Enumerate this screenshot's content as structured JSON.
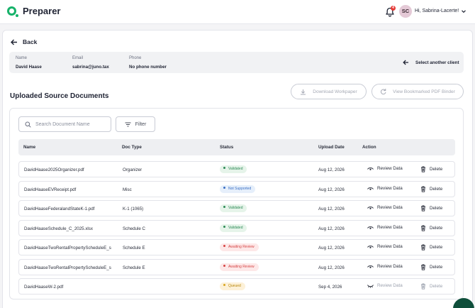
{
  "header": {
    "logo_text": "Preparer",
    "notification_count": "4",
    "avatar_initials": "SC",
    "greeting": "Hi, Sabrina-Lacerte!",
    "icons": [
      "logo-icon",
      "bell-icon",
      "chevron-down-icon"
    ]
  },
  "nav": {
    "back_label": "Back"
  },
  "client": {
    "name_label": "Name",
    "name": "David Haase",
    "email_label": "Email",
    "email": "sabrina@juno.tax",
    "phone_label": "Phone",
    "phone": "No phone number",
    "select_label": "Select another client"
  },
  "section": {
    "title": "Uploaded Source Documents",
    "download_label": "Download Workpaper",
    "view_binder_label": "View Bookmarked PDF Binder"
  },
  "toolbar": {
    "search_placeholder": "Search Document Name",
    "filter_label": "Filter"
  },
  "table": {
    "columns": [
      "Name",
      "Doc Type",
      "Status",
      "Upload Date",
      "Action"
    ],
    "review_label": "Review Data",
    "delete_label": "Delete",
    "rows": [
      {
        "name": "DavidHaase2025Organizer.pdf",
        "type": "Organizer",
        "status": "Validated",
        "date": "Aug 12, 2026"
      },
      {
        "name": "DavidHaaseEVReceipt.pdf",
        "type": "Misc",
        "status": "Not Supported",
        "date": "Aug 12, 2026"
      },
      {
        "name": "DavidHaaseFederalandStateK-1.pdf",
        "type": "K-1 (1065)",
        "status": "Validated",
        "date": "Aug 12, 2026"
      },
      {
        "name": "DavidHaaseSchedule_C_2025.xlsx",
        "type": "Schedule C",
        "status": "Validated",
        "date": "Aug 12, 2026"
      },
      {
        "name": "DavidHaaseTwoRentalPropertyScheduleE_s",
        "type": "Schedule E",
        "status": "Awaiting Review",
        "date": "Aug 12, 2026"
      },
      {
        "name": "DavidHaaseTwoRentalPropertyScheduleE_s",
        "type": "Schedule E",
        "status": "Awaiting Review",
        "date": "Aug 12, 2026"
      },
      {
        "name": "DavidHaaseW-2.pdf",
        "type": "",
        "status": "Queued",
        "date": "Sep 4, 2026"
      }
    ]
  },
  "colors": {
    "brand": "#17b26a",
    "validated": "#2e8b57",
    "not_supported": "#3a6fc4",
    "awaiting_review": "#d64545",
    "queued": "#b8860b"
  }
}
